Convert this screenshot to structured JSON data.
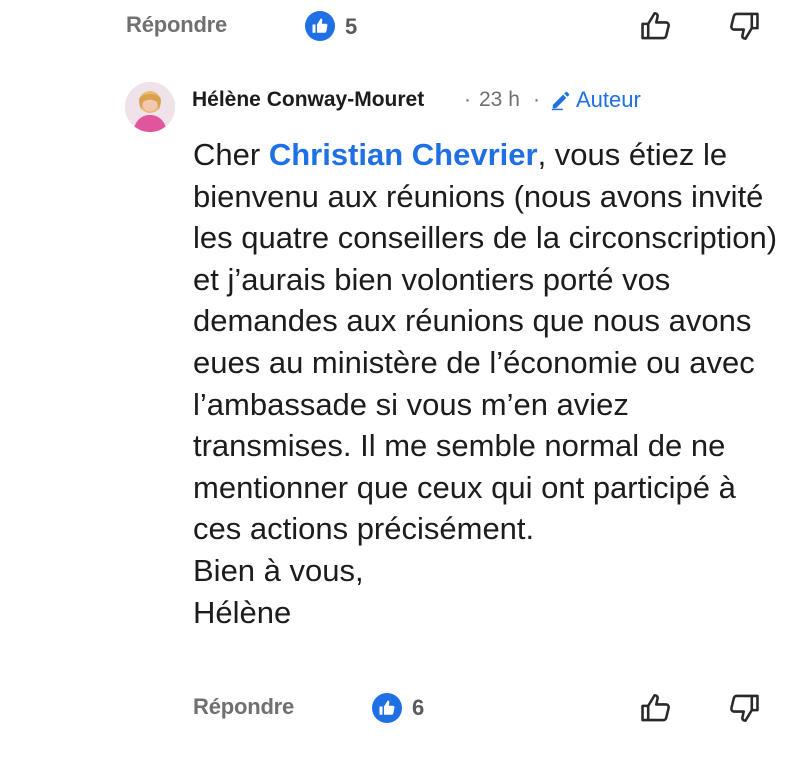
{
  "top_actions": {
    "reply_label": "Répondre",
    "like_count": "5"
  },
  "comment": {
    "author": "Hélène Conway-Mouret",
    "separator": "·",
    "time": "23 h",
    "author_badge": "Auteur",
    "body": {
      "line1_prefix": "Cher ",
      "mention": "Christian Chevrier",
      "line1_suffix": ", vous étiez le bienvenu aux réunions (nous avons invité les quatre conseillers de la circonscription) et j’aurais bien volontiers porté vos demandes aux réunions que nous avons eues au ministère de l’économie ou avec l’ambassade si vous m’en aviez transmises. Il me semble normal de ne mentionner que ceux qui ont participé à ces actions précisément.",
      "closing": "Bien à vous,",
      "signature": "Hélène"
    },
    "actions": {
      "reply_label": "Répondre",
      "like_count": "6"
    }
  },
  "icons": {
    "like_badge": "thumbs-up-filled-icon",
    "like": "thumbs-up-outline-icon",
    "dislike": "thumbs-down-outline-icon",
    "author_badge": "pencil-icon"
  },
  "colors": {
    "accent": "#1f6fe5",
    "muted": "#707070",
    "text": "#1c1c1c"
  }
}
